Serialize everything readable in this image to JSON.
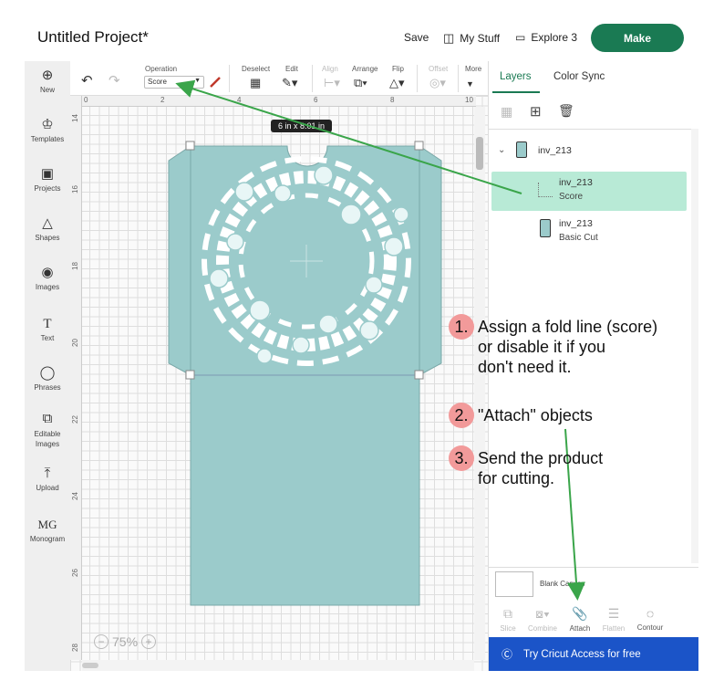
{
  "header": {
    "title": "Untitled Project*",
    "save_label": "Save",
    "my_stuff_label": "My Stuff",
    "machine_label": "Explore 3",
    "make_label": "Make"
  },
  "sidebar": {
    "items": [
      {
        "label": "New",
        "icon": "plus-circle-icon"
      },
      {
        "label": "Templates",
        "icon": "shirt-icon"
      },
      {
        "label": "Projects",
        "icon": "project-icon"
      },
      {
        "label": "Shapes",
        "icon": "shapes-icon"
      },
      {
        "label": "Images",
        "icon": "lightbulb-icon"
      },
      {
        "label": "Text",
        "icon": "text-icon"
      },
      {
        "label": "Phrases",
        "icon": "speech-bubble-icon"
      },
      {
        "label": "Editable Images",
        "icon": "editable-image-icon"
      },
      {
        "label": "Upload",
        "icon": "upload-icon"
      },
      {
        "label": "Monogram",
        "icon": "monogram-icon"
      }
    ]
  },
  "toolbar": {
    "operation_label": "Operation",
    "operation_value": "Score",
    "deselect_label": "Deselect",
    "edit_label": "Edit",
    "align_label": "Align",
    "arrange_label": "Arrange",
    "flip_label": "Flip",
    "offset_label": "Offset",
    "more_label": "More"
  },
  "canvas": {
    "ruler_top": [
      "0",
      "2",
      "4",
      "6",
      "8",
      "10"
    ],
    "ruler_left": [
      "14",
      "16",
      "18",
      "20",
      "22",
      "24",
      "26",
      "28"
    ],
    "size_tooltip": "6 in x 8.01 in",
    "zoom_level": "75%"
  },
  "layers_panel": {
    "tab_layers": "Layers",
    "tab_color_sync": "Color Sync",
    "group_name": "inv_213",
    "layers": [
      {
        "name": "inv_213",
        "operation": "Score",
        "selected": true
      },
      {
        "name": "inv_213",
        "operation": "Basic Cut",
        "selected": false
      }
    ],
    "blank_canvas_label": "Blank Canvas",
    "tools": [
      "Slice",
      "Combine",
      "Attach",
      "Flatten",
      "Contour"
    ],
    "access_label": "Try Cricut Access for free"
  },
  "instructions": [
    {
      "num": "1.",
      "text_lines": [
        "Assign a fold line (score)",
        "or disable it if you",
        "don't need it."
      ]
    },
    {
      "num": "2.",
      "text_lines": [
        "\"Attach\" objects"
      ]
    },
    {
      "num": "3.",
      "text_lines": [
        "Send the product",
        "for cutting."
      ]
    }
  ],
  "colors": {
    "brand_green": "#1a7a53",
    "card_fill": "#9bcbcb",
    "selected_layer": "#b8ead6",
    "annotation_arrow": "#3aa54a",
    "step_badge": "#f29a9a",
    "access_bar": "#1b54c8"
  }
}
